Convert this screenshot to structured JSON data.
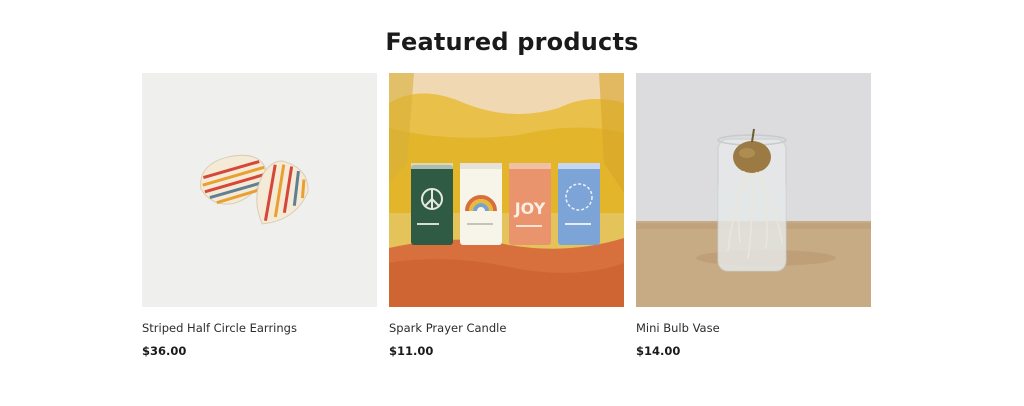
{
  "section": {
    "heading": "Featured products"
  },
  "products": [
    {
      "title": "Striped Half Circle Earrings",
      "price": "$36.00",
      "image": "earrings-photo"
    },
    {
      "title": "Spark Prayer Candle",
      "price": "$11.00",
      "image": "candles-photo",
      "candle_labels": [
        "JOY"
      ]
    },
    {
      "title": "Mini Bulb Vase",
      "price": "$14.00",
      "image": "vase-photo"
    }
  ]
}
